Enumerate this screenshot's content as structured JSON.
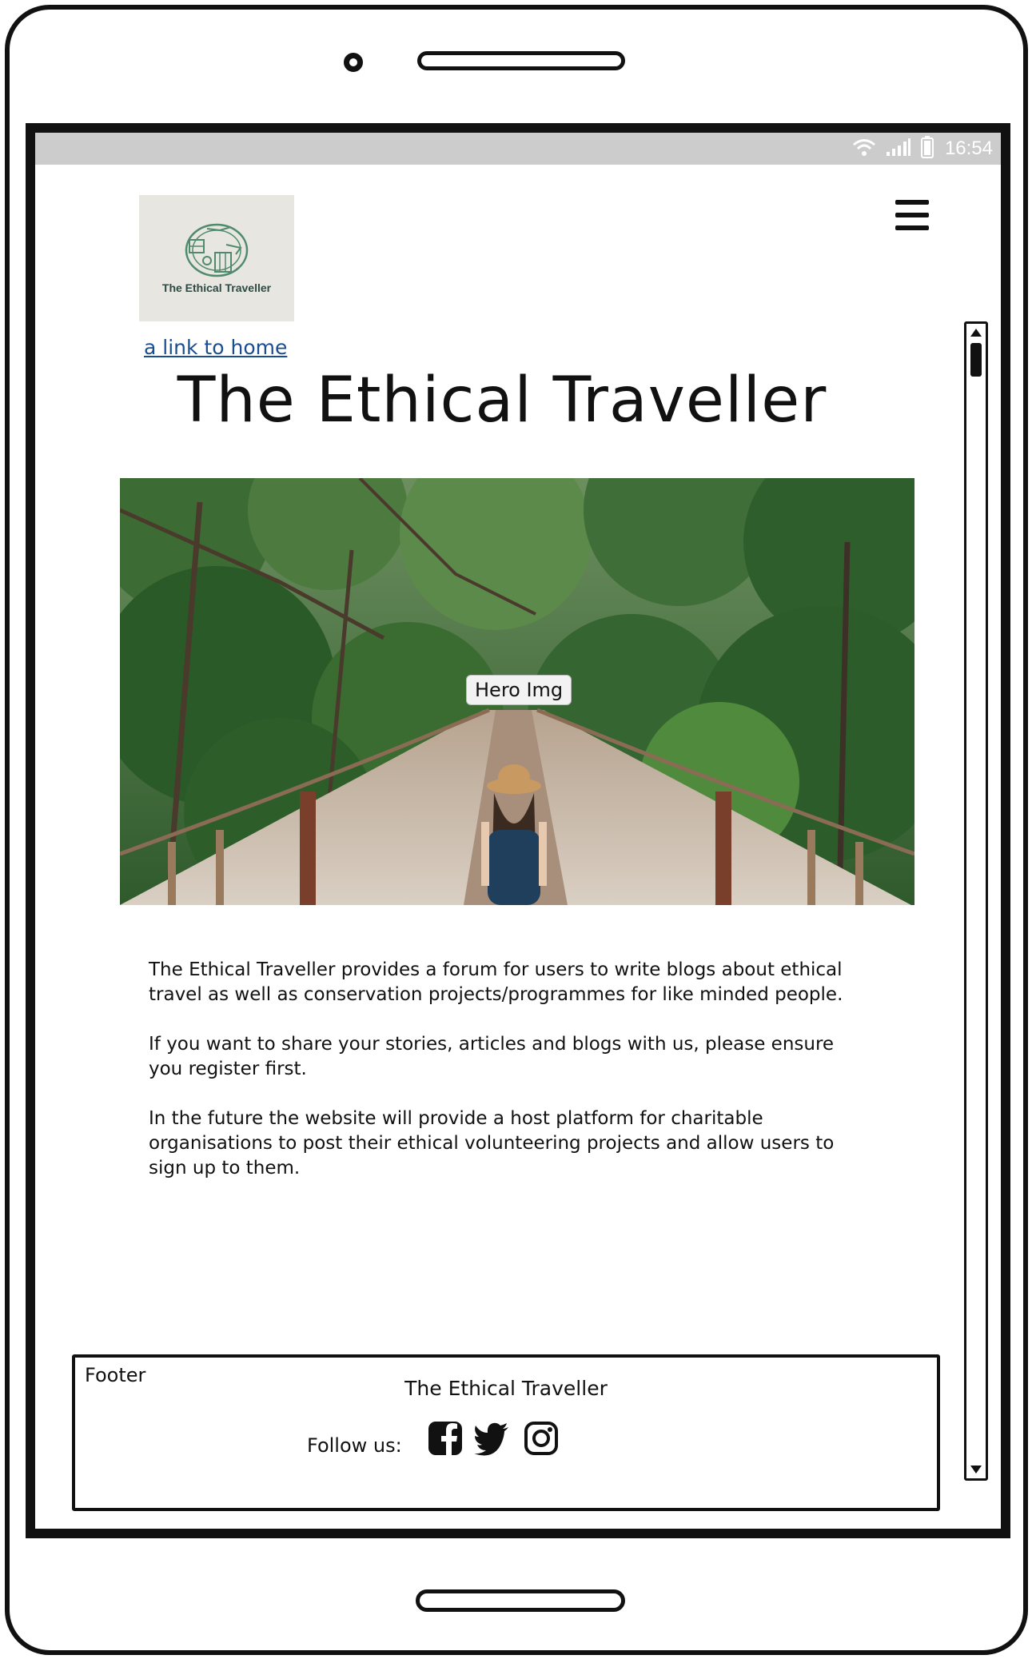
{
  "status_bar": {
    "time": "16:54",
    "icons": [
      "wifi-icon",
      "signal-icon",
      "battery-icon"
    ]
  },
  "header": {
    "logo_text": "The Ethical Traveller",
    "home_link": "a link to home",
    "menu_icon": "hamburger-menu-icon"
  },
  "main": {
    "title": "The Ethical Traveller",
    "hero_label": "Hero Img",
    "paragraphs": [
      "The Ethical Traveller provides a forum for users to write blogs about ethical travel as well as conservation projects/programmes for like minded people.",
      "If you want to share your stories, articles and blogs with us, please ensure you register first.",
      "In the future the website will provide a host platform for charitable organisations to post their ethical volunteering projects and allow users to sign up to them."
    ]
  },
  "footer": {
    "label": "Footer",
    "title": "The Ethical Traveller",
    "follow_label": "Follow us:",
    "social_icons": [
      "facebook-icon",
      "twitter-icon",
      "instagram-icon"
    ]
  },
  "colors": {
    "link": "#1a4d8f",
    "status_bar": "#cccccc",
    "logo_bg": "#e8e6e1",
    "logo_green": "#4f8a6c"
  }
}
